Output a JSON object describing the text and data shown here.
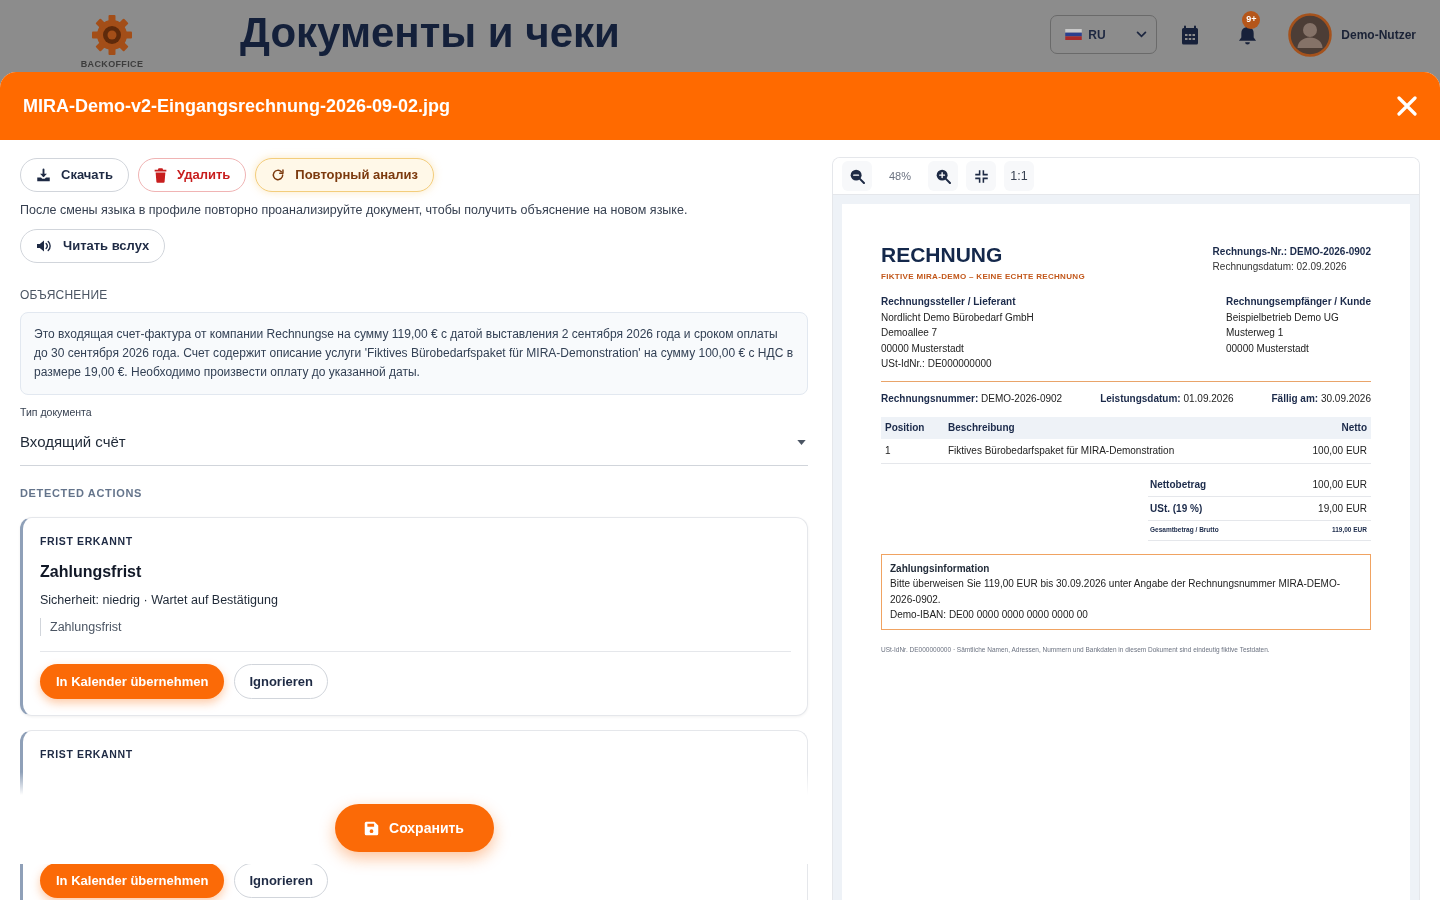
{
  "app_header": {
    "logo_text": "BACKOFFICE",
    "title": "Документы и чеки",
    "language": "RU",
    "notification_badge": "9+",
    "user_name": "Demo-Nutzer"
  },
  "modal": {
    "title": "MIRA-Demo-v2-Eingangsrechnung-2026-09-02.jpg"
  },
  "actions": [
    {
      "kind": "download",
      "label": "Скачать"
    },
    {
      "kind": "delete",
      "label": "Удалить"
    },
    {
      "kind": "reanalyze",
      "label": "Повторный анализ"
    }
  ],
  "language_hint": "После смены языка в профиле повторно проанализируйте документ, чтобы получить объяснение на новом языке.",
  "read_aloud": {
    "label": "Читать вслух"
  },
  "explanation": {
    "heading": "ОБЪЯСНЕНИЕ",
    "text": "Это входящая счет-фактура от компании Rechnungse на сумму 119,00 € с датой выставления 2 сентября 2026 года и сроком оплаты до 30 сентября 2026 года. Счет содержит описание услуги 'Fiktives Bürobedarfspaket für MIRA-Demonstration' на сумму 100,00 € с НДС в размере 19,00 €. Необходимо произвести оплату до указанной даты."
  },
  "document_type": {
    "label": "Тип документа",
    "value": "Входящий счёт"
  },
  "detected_actions": {
    "heading": "DETECTED ACTIONS",
    "cards": [
      {
        "label": "FRIST ERKANNT",
        "title": "Zahlungsfrist",
        "meta": "Sicherheit: niedrig · Wartet auf Bestätigung",
        "quote": "Zahlungsfrist",
        "buttons": [
          {
            "kind": "primary",
            "label": "In Kalender übernehmen"
          },
          {
            "kind": "secondary",
            "label": "Ignorieren"
          }
        ]
      },
      {
        "label": "FRIST ERKANNT",
        "buttons": [
          {
            "kind": "primary",
            "label": "In Kalender übernehmen"
          },
          {
            "kind": "secondary",
            "label": "Ignorieren"
          }
        ]
      }
    ]
  },
  "save_button": {
    "label": "Сохранить"
  },
  "viewer": {
    "zoom_level": "48%",
    "actual_size": "1:1",
    "document": {
      "title": "RECHNUNG",
      "subtitle": "FIKTIVE MIRA-DEMO – KEINE ECHTE RECHNUNG",
      "header_lines": [
        {
          "kind": "strong",
          "text": "Rechnungs-Nr.: DEMO-2026-0902"
        },
        {
          "kind": "plain",
          "text": "Rechnungsdatum: 02.09.2026"
        }
      ],
      "parties": [
        {
          "heading": "Rechnungssteller / Lieferant",
          "lines": [
            "Nordlicht Demo Bürobedarf GmbH",
            "Demoallee 7",
            "00000 Musterstadt",
            "USt-IdNr.: DE000000000"
          ]
        },
        {
          "heading": "Rechnungsempfänger / Kunde",
          "lines": [
            "Beispielbetrieb Demo UG",
            "Musterweg 1",
            "00000 Musterstadt"
          ]
        }
      ],
      "details": [
        "**Rechnungsnummer:** DEMO-2026-0902",
        "**Leistungsdatum:** 01.09.2026",
        "**Fällig am:** 30.09.2026"
      ],
      "table": {
        "columns": [
          "Position",
          "Beschreibung",
          "Netto"
        ],
        "rows": [
          [
            "1",
            "Fiktives Bürobedarfspaket für MIRA-Demonstration",
            "100,00 EUR"
          ]
        ]
      },
      "totals": [
        {
          "kind": "regular",
          "label": "Nettobetrag",
          "value": "100,00 EUR"
        },
        {
          "kind": "regular",
          "label": "USt. (19 %)",
          "value": "19,00 EUR"
        },
        {
          "kind": "grand",
          "label": "Gesamtbetrag / Brutto",
          "value": "119,00 EUR"
        }
      ],
      "payment": {
        "heading": "Zahlungsinformation",
        "lines": [
          "Bitte überweisen Sie 119,00 EUR bis 30.09.2026 unter Angabe der Rechnungsnummer MIRA-DEMO-2026-0902.",
          "Demo-IBAN: DE00 0000 0000 0000 0000 00"
        ]
      },
      "footer": "USt-IdNr. DE000000000 · Sämtliche Namen, Adressen, Nummern und Bankdaten in diesem Dokument sind eindeutig fiktive Testdaten."
    }
  }
}
